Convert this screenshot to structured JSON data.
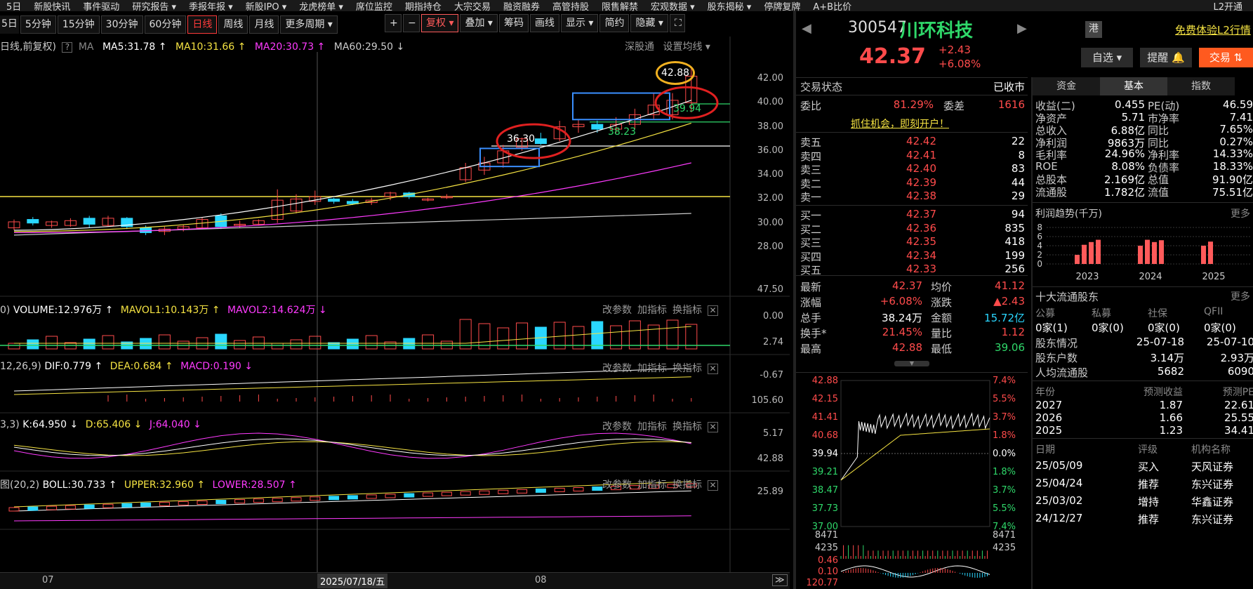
{
  "menubar": {
    "items": [
      "5日",
      "新股快讯",
      "事件驱动",
      "研究报告 ▾",
      "季报年报 ▾",
      "新股IPO ▾",
      "龙虎榜单 ▾",
      "席位监控",
      "期指持仓",
      "大宗交易",
      "融资融券",
      "高管持股",
      "限售解禁",
      "宏观数据 ▾",
      "股东揭秘 ▾",
      "停牌复牌",
      "A+B比价"
    ],
    "right": "L2开通"
  },
  "periods": {
    "first": "5日",
    "items": [
      "5分钟",
      "15分钟",
      "30分钟",
      "60分钟",
      "日线",
      "周线",
      "月线",
      "更多周期 ▾"
    ],
    "active": "日线"
  },
  "toolbar": {
    "plus": "+",
    "minus": "−",
    "fuquan": "复权 ▾",
    "diejia": "叠加 ▾",
    "chouma": "筹码",
    "huaxian": "画线",
    "xianshi": "显示 ▾",
    "jianyue": "简约",
    "yincang": "隐藏 ▾"
  },
  "main_legend": {
    "prefix": "日线,前复权)",
    "help": "?",
    "ma": "MA",
    "ma5": "MA5:31.78 ↑",
    "ma10": "MA10:31.66 ↑",
    "ma20": "MA20:30.73 ↑",
    "ma60": "MA60:29.50 ↓",
    "shengutong": "深股通",
    "setting": "设置均线 ▾"
  },
  "price_axis": [
    "42.00",
    "40.00",
    "38.00",
    "36.00",
    "34.00",
    "32.00",
    "30.00",
    "28.00"
  ],
  "annotations": {
    "high": "42.88",
    "level1": "39.94",
    "level2": "38.23",
    "level3": "36.30"
  },
  "volume_legend": {
    "prefix": "0)",
    "vol": "VOLUME:12.976万 ↑",
    "mavol1": "MAVOL1:10.143万 ↑",
    "mavol2": "MAVOL2:14.624万 ↓"
  },
  "volume_axis": [
    "47.50",
    "0.00"
  ],
  "macd_legend": {
    "prefix": "12,26,9)",
    "dif": "DIF:0.779 ↑",
    "dea": "DEA:0.684 ↑",
    "macd": "MACD:0.190 ↓"
  },
  "macd_axis": [
    "2.74",
    "-0.67"
  ],
  "kdj_legend": {
    "prefix": "3,3)",
    "k": "K:64.950 ↓",
    "d": "D:65.406 ↓",
    "j": "J:64.040 ↓"
  },
  "kdj_axis": [
    "105.60",
    "5.17"
  ],
  "boll_legend": {
    "prefix": "图(20,2)",
    "boll": "BOLL:30.733 ↑",
    "upper": "UPPER:32.960 ↑",
    "lower": "LOWER:28.507 ↑"
  },
  "boll_axis": [
    "42.88",
    "25.89"
  ],
  "panel_tools": [
    "改参数",
    "加指标",
    "换指标"
  ],
  "close_x": "✕",
  "xaxis": {
    "left": "07",
    "cursor": "2025/07/18/五",
    "mid": "08",
    "end": "≫"
  },
  "stock": {
    "code": "300547",
    "name": "川环科技",
    "price": "42.37",
    "change": "+2.43",
    "pct": "+6.08%",
    "hk": "港",
    "promo": "免费体验L2行情",
    "zixuan": "自选 ▾",
    "tixing": "提醒 🔔",
    "jiaoyi": "交易 ⇅"
  },
  "trade": {
    "status_label": "交易状态",
    "status": "已收市",
    "weibi_label": "委比",
    "weibi": "81.29%",
    "weicha_label": "委差",
    "weicha": "1616",
    "promo": "抓住机会，即刻开户！",
    "sells": [
      [
        "卖五",
        "42.42",
        "22"
      ],
      [
        "卖四",
        "42.41",
        "8"
      ],
      [
        "卖三",
        "42.40",
        "83"
      ],
      [
        "卖二",
        "42.39",
        "44"
      ],
      [
        "卖一",
        "42.38",
        "29"
      ]
    ],
    "buys": [
      [
        "买一",
        "42.37",
        "94"
      ],
      [
        "买二",
        "42.36",
        "835"
      ],
      [
        "买三",
        "42.35",
        "418"
      ],
      [
        "买四",
        "42.34",
        "199"
      ],
      [
        "买五",
        "42.33",
        "256"
      ]
    ],
    "stats": [
      [
        "最新",
        "42.37",
        "均价",
        "41.12"
      ],
      [
        "涨幅",
        "+6.08%",
        "涨跌",
        "▲2.43"
      ],
      [
        "总手",
        "38.24万",
        "金额",
        "15.72亿"
      ],
      [
        "换手*",
        "21.45%",
        "量比",
        "1.12"
      ],
      [
        "最高",
        "42.88",
        "最低",
        "39.06"
      ]
    ]
  },
  "intraday": {
    "left_axis": [
      "42.88",
      "42.15",
      "41.41",
      "40.68",
      "39.94",
      "39.21",
      "38.47",
      "37.73",
      "37.00"
    ],
    "right_axis": [
      "7.4%",
      "5.5%",
      "3.7%",
      "1.8%",
      "0.0%",
      "1.8%",
      "3.7%",
      "5.5%",
      "7.4%"
    ],
    "vol_left": [
      "8471",
      "4235"
    ],
    "vol_right": [
      "8471",
      "4235"
    ],
    "sub_left": [
      "0.46",
      "0.10",
      "120.77"
    ]
  },
  "fin_tabs": [
    "资金",
    "基本",
    "指数"
  ],
  "fin_active": "基本",
  "fin": [
    [
      "收益(二)",
      "0.455",
      "PE(动)",
      "46.59"
    ],
    [
      "净资产",
      "5.71",
      "市净率",
      "7.41"
    ],
    [
      "总收入",
      "6.88亿",
      "同比",
      "7.65%"
    ],
    [
      "净利润",
      "9863万",
      "同比",
      "0.27%"
    ],
    [
      "毛利率",
      "24.96%",
      "净利率",
      "14.33%"
    ],
    [
      "ROE",
      "8.08%",
      "负债率",
      "18.33%"
    ],
    [
      "总股本",
      "2.169亿",
      "总值",
      "91.90亿"
    ],
    [
      "流通股",
      "1.782亿",
      "流值",
      "75.51亿"
    ]
  ],
  "profit": {
    "title": "利润趋势(千万)",
    "more": "更多",
    "y": [
      "8",
      "6",
      "4",
      "2",
      "0"
    ],
    "years": [
      "2023",
      "2024",
      "2025"
    ],
    "bars": [
      [
        2.0,
        4.2,
        4.8,
        5.3
      ],
      [
        4.0,
        5.3,
        4.8,
        5.2
      ],
      [
        4.0,
        4.9
      ]
    ]
  },
  "holders": {
    "title": "十大流通股东",
    "more": "更多",
    "cols": [
      "公募",
      "私募",
      "社保",
      "QFII"
    ],
    "vals": [
      "0家(1)",
      "0家(0)",
      "0家(0)",
      "0家(0)"
    ],
    "rows": [
      [
        "股东情况",
        "25-07-18",
        "25-07-10"
      ],
      [
        "股东户数",
        "3.14万",
        "2.93万"
      ],
      [
        "人均流通股",
        "5682",
        "6090"
      ]
    ]
  },
  "forecast": {
    "cols": [
      "年份",
      "预测收益",
      "预测PE"
    ],
    "rows": [
      [
        "2027",
        "1.87",
        "22.61"
      ],
      [
        "2026",
        "1.66",
        "25.55"
      ],
      [
        "2025",
        "1.23",
        "34.41"
      ]
    ]
  },
  "ratings": {
    "cols": [
      "日期",
      "评级",
      "机构名称"
    ],
    "rows": [
      [
        "25/05/09",
        "买入",
        "天风证券"
      ],
      [
        "25/04/24",
        "推荐",
        "东兴证券"
      ],
      [
        "25/03/02",
        "增持",
        "华鑫证券"
      ],
      [
        "24/12/27",
        "推荐",
        "东兴证券"
      ]
    ]
  },
  "colors": {
    "up": "#ff4b4b",
    "down": "#2ad7ff",
    "ma5": "#ffffff",
    "ma10": "#f5e342",
    "ma20": "#ff3bff",
    "ma60": "#cccccc"
  }
}
